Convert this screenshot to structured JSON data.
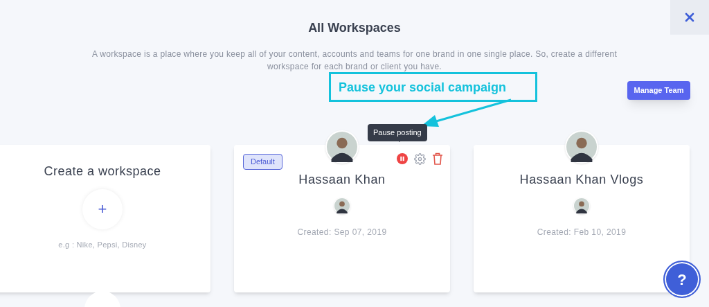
{
  "header": {
    "title": "All Workspaces",
    "description": "A workspace is a place where you keep all of your content, accounts and teams for one brand in one single place. So, create a different workspace for each brand or client you have."
  },
  "manage_team_button": {
    "label": "Manage Team"
  },
  "annotation": {
    "text": "Pause your social campaign"
  },
  "tooltip": {
    "text": "Pause posting"
  },
  "create_card": {
    "title": "Create a workspace",
    "add_label": "+",
    "hint": "e.g : Nike, Pepsi, Disney"
  },
  "workspaces": [
    {
      "name": "Hassaan Khan",
      "created": "Created: Sep 07, 2019",
      "badge": "Default",
      "actions_visible": true
    },
    {
      "name": "Hassaan Khan Vlogs",
      "created": "Created: Feb 10, 2019",
      "actions_visible": false
    }
  ],
  "help_button": {
    "label": "?"
  }
}
